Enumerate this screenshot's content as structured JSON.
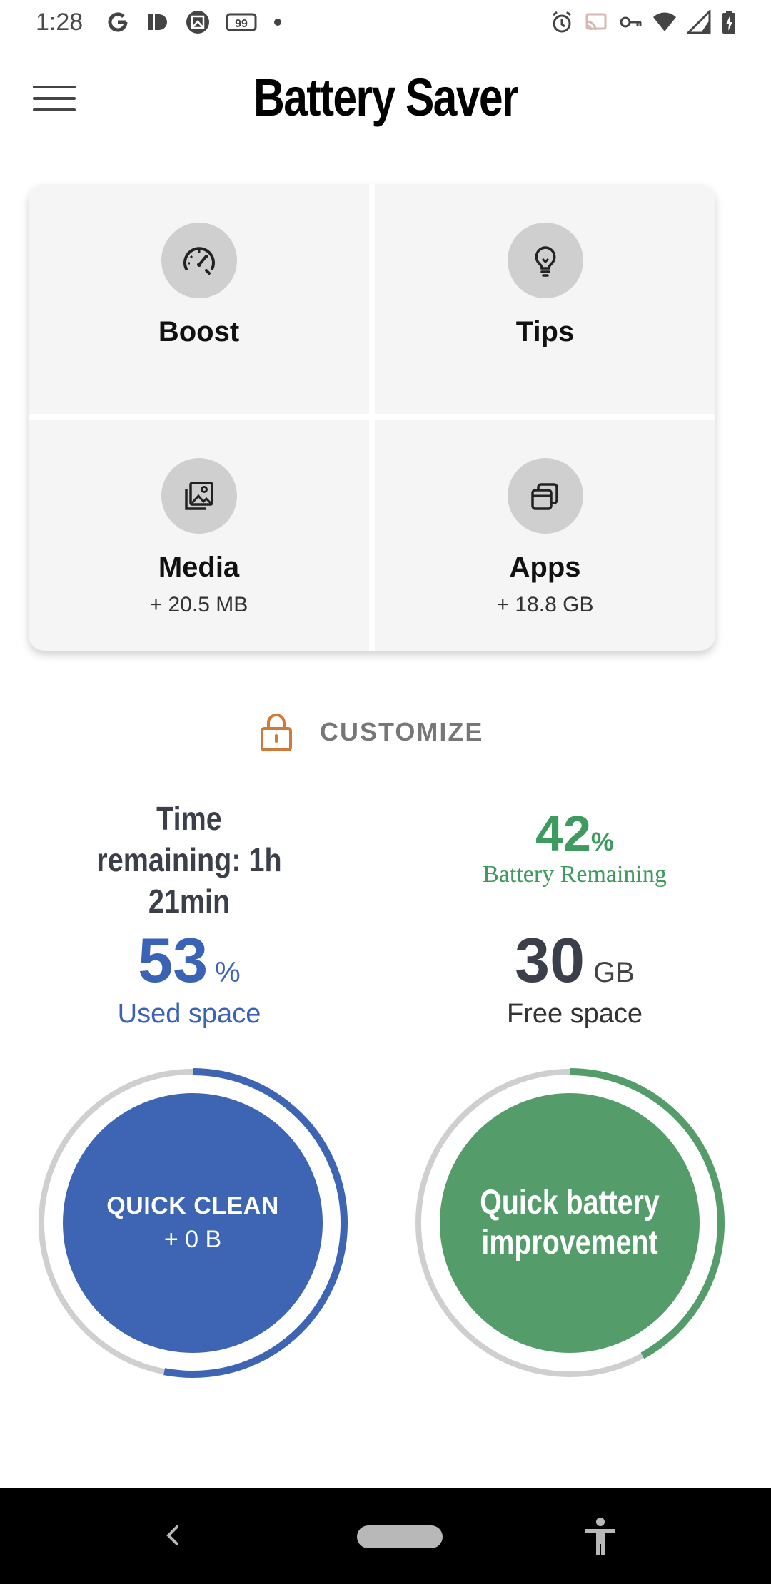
{
  "status_bar": {
    "time": "1:28",
    "left_icons": [
      "google-icon",
      "id-icon",
      "image-icon",
      "99-badge-icon",
      "dot-icon"
    ],
    "right_icons": [
      "alarm-icon",
      "cast-icon",
      "vpn-key-icon",
      "wifi-icon",
      "signal-icon",
      "battery-icon"
    ],
    "badge_99": "99"
  },
  "app_bar": {
    "title": "Battery Saver"
  },
  "grid": {
    "tiles": [
      {
        "label": "Boost",
        "sub": "",
        "icon": "speedometer-icon"
      },
      {
        "label": "Tips",
        "sub": "",
        "icon": "lightbulb-icon"
      },
      {
        "label": "Media",
        "sub": "+ 20.5 MB",
        "icon": "gallery-icon"
      },
      {
        "label": "Apps",
        "sub": "+ 18.8 GB",
        "icon": "apps-stack-icon"
      }
    ]
  },
  "customize": {
    "label": "CUSTOMIZE",
    "icon": "lock-icon",
    "icon_color": "#d07a3a"
  },
  "stats": {
    "time_remaining": "Time remaining: 1h 21min",
    "battery_pct": "42",
    "battery_pct_sign": "%",
    "battery_remaining_label": "Battery Remaining",
    "used_value": "53",
    "used_unit": "%",
    "used_label": "Used space",
    "free_value": "30",
    "free_unit": "GB",
    "free_label": "Free space"
  },
  "gauges": {
    "used_fraction": 0.53,
    "battery_fraction": 0.42,
    "quick_clean_label": "QUICK CLEAN",
    "quick_clean_sub": "+ 0 B",
    "quick_battery_label": "Quick battery improvement"
  },
  "colors": {
    "blue": "#3d65b3",
    "green": "#559c6b",
    "track": "#cfcfcf"
  },
  "nav_bar": {
    "icons": [
      "back-icon",
      "home-pill",
      "accessibility-icon"
    ]
  }
}
